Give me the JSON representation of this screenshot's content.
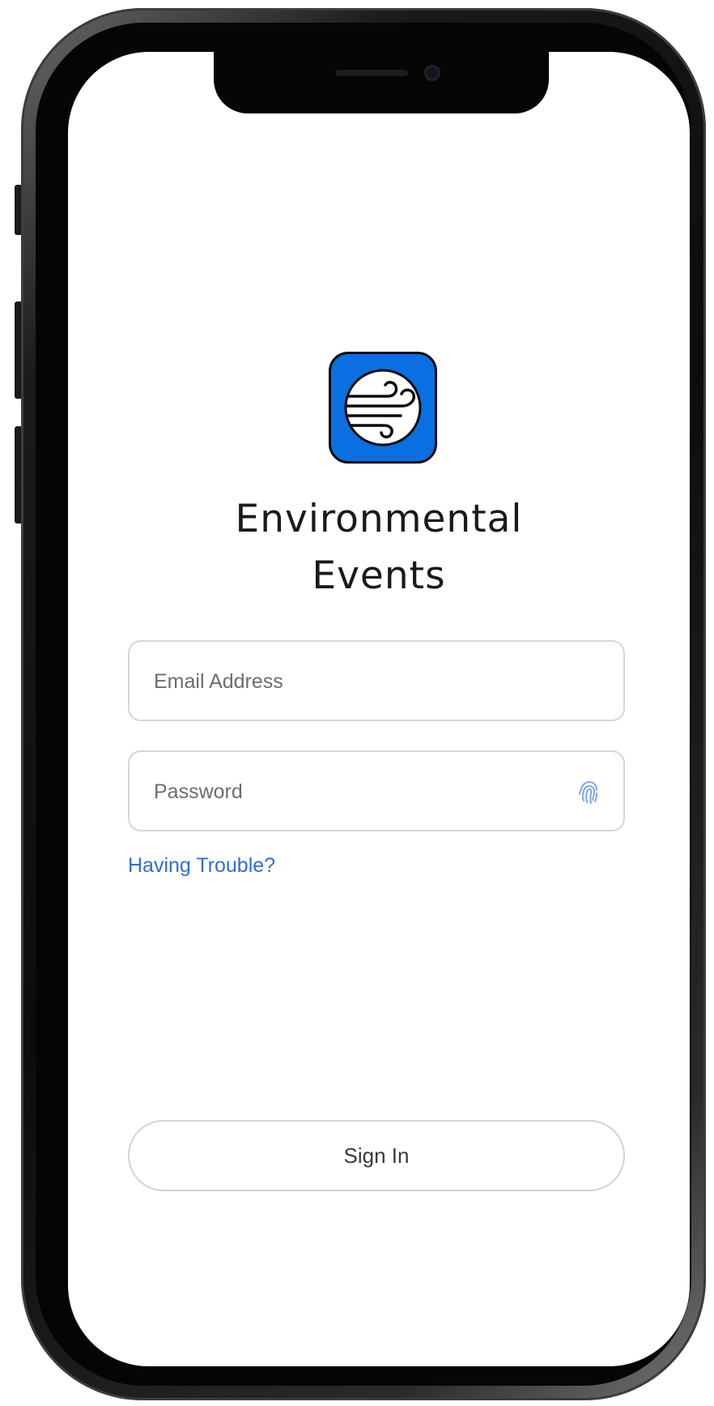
{
  "app": {
    "title_line1": "Environmental",
    "title_line2": "Events",
    "icon": "wind-icon",
    "accent_color": "#0a6fe0"
  },
  "form": {
    "email": {
      "placeholder": "Email Address",
      "value": ""
    },
    "password": {
      "placeholder": "Password",
      "value": "",
      "trailing_icon": "fingerprint-icon"
    },
    "help_link": "Having Trouble?",
    "link_color": "#2f6fcf"
  },
  "actions": {
    "sign_in_label": "Sign In"
  }
}
